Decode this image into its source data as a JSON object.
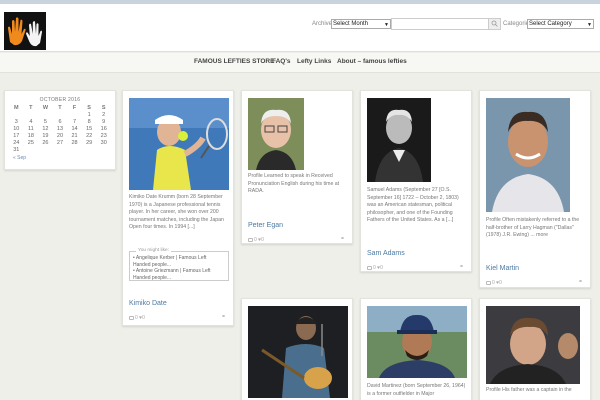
{
  "header": {
    "archives_label": "Archives",
    "archives_value": "Select Month",
    "categories_label": "Categories",
    "categories_value": "Select Category",
    "search_placeholder": ""
  },
  "nav": {
    "items": [
      "FAMOUS LEFTIES STORE",
      "FAQ's",
      "Lefty Links",
      "About – famous lefties"
    ]
  },
  "calendar": {
    "title": "OCTOBER 2016",
    "weekdays": [
      "M",
      "T",
      "W",
      "T",
      "F",
      "S",
      "S"
    ],
    "days": [
      "",
      "",
      "",
      "",
      "",
      "1",
      "2",
      "3",
      "4",
      "5",
      "6",
      "7",
      "8",
      "9",
      "10",
      "11",
      "12",
      "13",
      "14",
      "15",
      "16",
      "17",
      "18",
      "19",
      "20",
      "21",
      "22",
      "23",
      "24",
      "25",
      "26",
      "27",
      "28",
      "29",
      "30",
      "31",
      "",
      "",
      "",
      "",
      "",
      ""
    ],
    "prev_label": "« Sep"
  },
  "posts": [
    {
      "title": "Kimiko Date",
      "excerpt": "Kimiko Date Krumm (born 28 September 1970) is a Japanese professional tennis player. In her career, she won over 200 tournament matches, including the Japan Open four times. In 1994 [...]",
      "related_label": "You might like:",
      "related": [
        "Angelique Kerber | Famous Left Handed people...",
        "Antoine Griezmann | Famous Left Handed people..."
      ],
      "comments": "0",
      "likes": "0"
    },
    {
      "title": "Peter Egan",
      "excerpt": "Profile Learned to speak in Received Pronunciation English during his time at RADA.",
      "comments": "0",
      "likes": "0"
    },
    {
      "title": "Sam Adams",
      "excerpt": "Samuel Adams (September 27 [O.S. September 16] 1722 – October 2, 1803) was an American statesman, political philosopher, and one of the Founding Fathers of the United States. As a [...]",
      "comments": "0",
      "likes": "0"
    },
    {
      "title": "Kiel Martin",
      "excerpt": "Profile Often mistakenly referred to a the half-brother of Larry Hagman (\"Dallas\" (1978) J.R. Ewing) ... more",
      "comments": "0",
      "likes": "0"
    },
    {
      "excerpt": "David Martinez (born September 26, 1964) is a former outfielder in Major"
    },
    {
      "excerpt": "Profile His father was a captain in the"
    }
  ],
  "colors": {
    "link": "#4b7aa3",
    "background": "#efefea"
  }
}
